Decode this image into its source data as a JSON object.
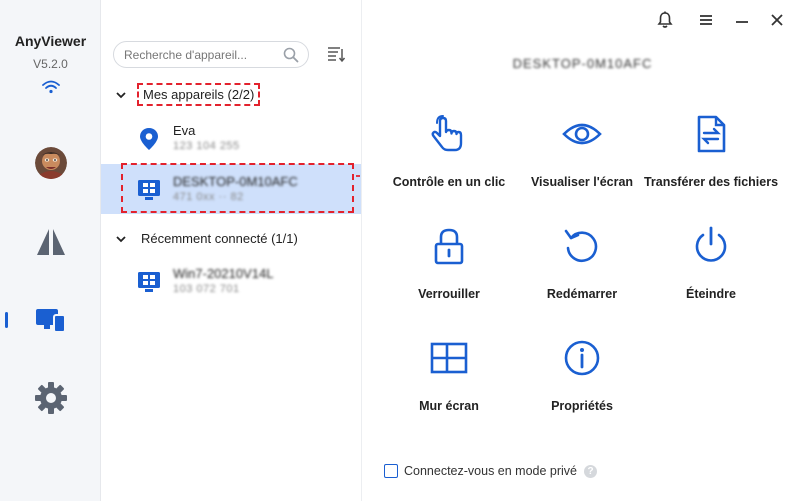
{
  "app": {
    "name": "AnyViewer",
    "version": "V5.2.0"
  },
  "search": {
    "placeholder": "Recherche d'appareil..."
  },
  "groups": [
    {
      "label": "Mes appareils (2/2)",
      "devices": [
        {
          "name": "Eva",
          "sub": "123 104 255"
        },
        {
          "name": "DESKTOP-0M10AFC",
          "sub": "471 0xx ·· 82"
        }
      ]
    },
    {
      "label": "Récemment connecté (1/1)",
      "devices": [
        {
          "name": "Win7-20210V14L",
          "sub": "103 072 701"
        }
      ]
    }
  ],
  "main": {
    "device_title": "DESKTOP-0M10AFC",
    "actions": [
      {
        "label": "Contrôle en un clic",
        "icon": "hand-pointer-icon"
      },
      {
        "label": "Visualiser l'écran",
        "icon": "eye-icon"
      },
      {
        "label": "Transférer des fichiers",
        "icon": "file-transfer-icon"
      },
      {
        "label": "Verrouiller",
        "icon": "lock-icon"
      },
      {
        "label": "Redémarrer",
        "icon": "restart-icon"
      },
      {
        "label": "Éteindre",
        "icon": "power-icon"
      },
      {
        "label": "Mur écran",
        "icon": "screen-wall-icon"
      },
      {
        "label": "Propriétés",
        "icon": "info-icon"
      }
    ],
    "private_mode_label": "Connectez-vous en mode privé",
    "help_mark": "?"
  },
  "colors": {
    "accent": "#1a5fd1",
    "highlight": "#e3222d",
    "selected_bg": "#cfe0fb"
  }
}
